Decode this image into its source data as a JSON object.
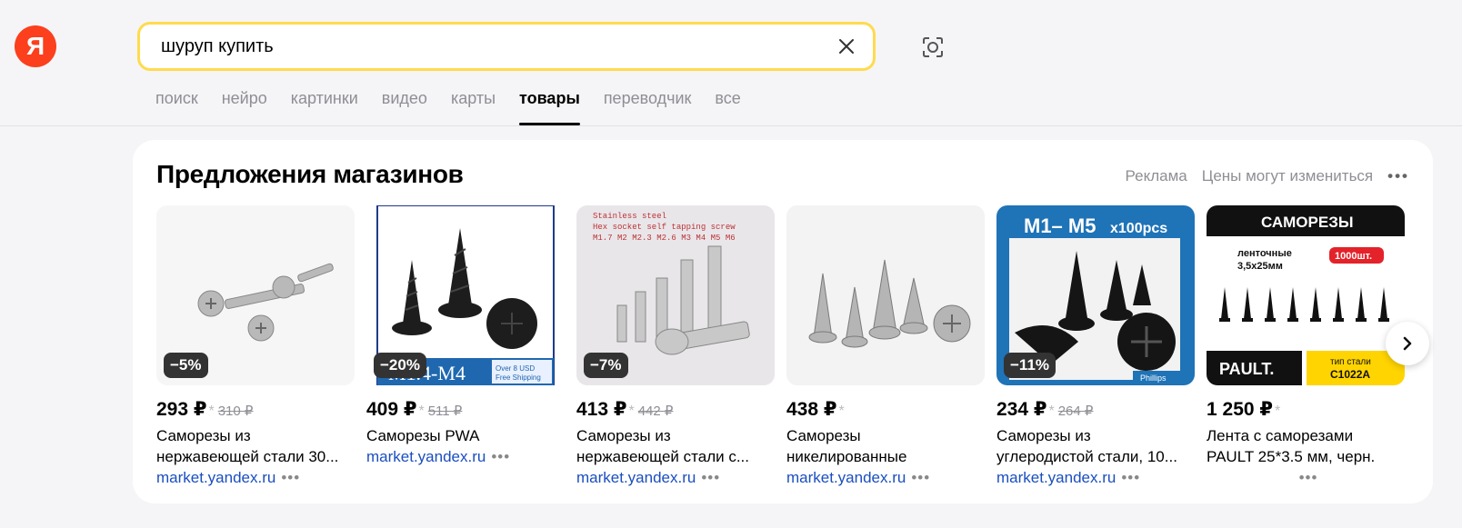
{
  "logo": {
    "letter": "Я"
  },
  "search": {
    "value": "шуруп купить",
    "placeholder": ""
  },
  "tabs": [
    {
      "label": "поиск"
    },
    {
      "label": "нейро"
    },
    {
      "label": "картинки"
    },
    {
      "label": "видео"
    },
    {
      "label": "карты"
    },
    {
      "label": "товары",
      "active": true
    },
    {
      "label": "переводчик"
    },
    {
      "label": "все"
    }
  ],
  "offers": {
    "title": "Предложения магазинов",
    "ad_label": "Реклама",
    "prices_note": "Цены могут измениться",
    "more": "•••"
  },
  "products": [
    {
      "discount": "−5%",
      "price": "293 ₽",
      "old_price": "310 ₽",
      "title_l1": "Саморезы из",
      "title_l2": "нержавеющей стали 30...",
      "shop": "market.yandex.ru",
      "dots": "•••"
    },
    {
      "discount": "−20%",
      "price": "409 ₽",
      "old_price": "511 ₽",
      "title_l1": "Саморезы PWA",
      "title_l2": "",
      "shop": "market.yandex.ru",
      "dots": "•••",
      "img_text": "M1.4-M4",
      "img_note": "Over 8 USD Free Shipping"
    },
    {
      "discount": "−7%",
      "price": "413 ₽",
      "old_price": "442 ₽",
      "title_l1": "Саморезы из",
      "title_l2": "нержавеющей стали с...",
      "shop": "market.yandex.ru",
      "dots": "•••",
      "img_text_1": "Stainless steel",
      "img_text_2": "Hex socket self tapping screw",
      "img_text_3": "M1.7 M2 M2.3 M2.6 M3 M4 M5 M6"
    },
    {
      "discount": "",
      "price": "438 ₽",
      "old_price": "",
      "title_l1": "Саморезы",
      "title_l2": "никелированные",
      "shop": "market.yandex.ru",
      "dots": "•••"
    },
    {
      "discount": "−11%",
      "price": "234 ₽",
      "old_price": "264 ₽",
      "title_l1": "Саморезы из",
      "title_l2": "углеродистой стали, 10...",
      "shop": "market.yandex.ru",
      "dots": "•••",
      "img_text": "M1– M5",
      "img_text_2": "x100pcs",
      "img_note": "Phillips"
    },
    {
      "discount": "",
      "price": "1 250 ₽",
      "old_price": "",
      "title_l1": "Лента с саморезами",
      "title_l2": "PAULT 25*3.5 мм, черн.",
      "shop": "",
      "dots": "•••",
      "img_head": "САМОРЕЗЫ",
      "img_sub_1": "ленточные",
      "img_sub_2": "3,5х25мм",
      "img_pill": "1000шт.",
      "img_brand": "PAULT.",
      "img_type_1": "тип стали",
      "img_type_2": "C1022A"
    }
  ],
  "colors": {
    "accent": "#ffdb4d",
    "logo": "#fc3f1d",
    "link": "#1a4ec0"
  },
  "icons": {
    "clear": "close-icon",
    "lens": "camera-search-icon",
    "next": "chevron-right-icon"
  }
}
